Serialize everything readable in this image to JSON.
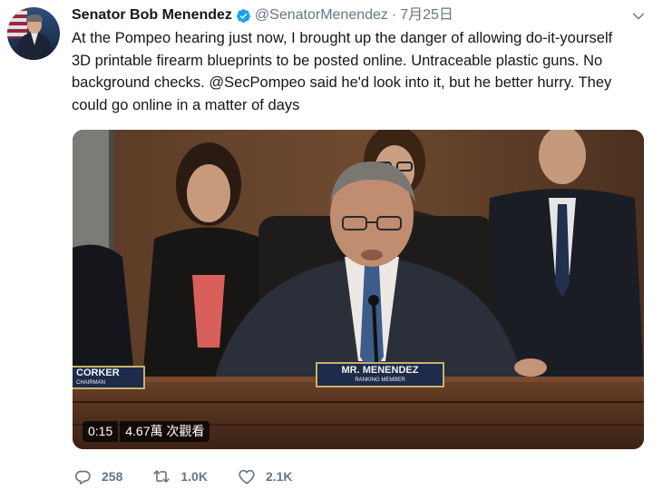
{
  "author": {
    "name": "Senator Bob Menendez",
    "handle": "@SenatorMenendez",
    "separator": "·",
    "date": "7月25日"
  },
  "tweet": {
    "text": "At the Pompeo hearing just now, I brought up the danger of allowing do-it-yourself 3D printable firearm blueprints to be posted online. Untraceable plastic guns. No background checks. @SecPompeo said he'd look into it, but he better hurry. They could go online in a matter of days"
  },
  "media": {
    "nameplate_main": "MR. MENENDEZ",
    "nameplate_sub": "RANKING MEMBER",
    "nameplate_left_main": "CORKER",
    "nameplate_left_sub": "CHAIRMAN",
    "duration": "0:15",
    "views": "4.67萬 次觀看"
  },
  "actions": {
    "replies": "258",
    "retweets": "1.0K",
    "likes": "2.1K"
  },
  "colors": {
    "verified": "#1da1f2",
    "secondary_text": "#657786",
    "primary_text": "#14171a"
  },
  "icons": [
    "verified-badge-icon",
    "chevron-down-icon",
    "reply-icon",
    "retweet-icon",
    "like-icon"
  ]
}
